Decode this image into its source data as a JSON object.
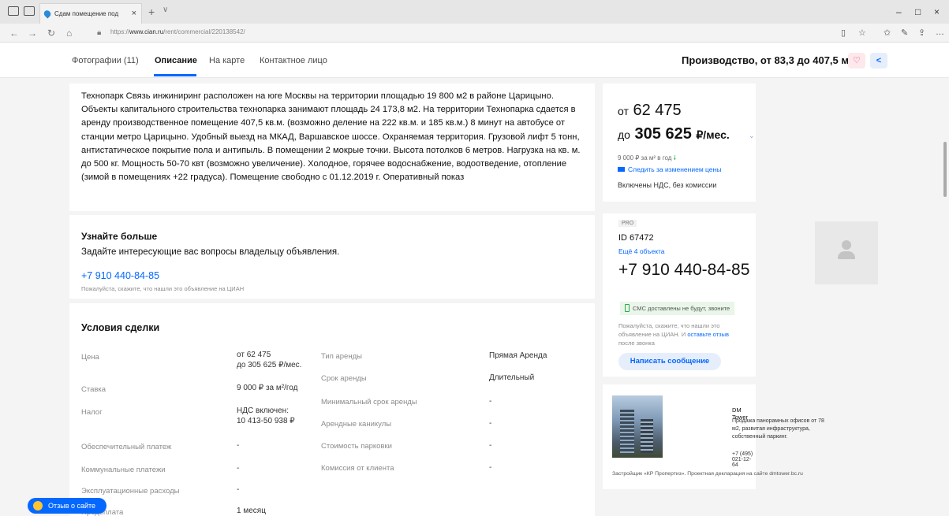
{
  "browser": {
    "tab_title": "Сдам помещение под",
    "url_prefix": "https://",
    "url_domain": "www.cian.ru",
    "url_path": "/rent/commercial/220138542/"
  },
  "header": {
    "tabs": [
      {
        "label": "Фотографии (11)"
      },
      {
        "label": "Описание"
      },
      {
        "label": "На карте"
      },
      {
        "label": "Контактное лицо"
      }
    ],
    "title": "Производство, от 83,3 до 407,5 м",
    "title_sup": "²"
  },
  "description": {
    "text": "Технопарк Связь инжиниринг расположен на юге Москвы на территории площадью 19 800 м2 в районе Царицыно. Объекты капитального строительства технопарка занимают площадь 24 173,8 м2. На территории Технопарка сдается в аренду производственное помещение 407,5 кв.м. (возможно деление на 222 кв.м. и 185 кв.м.) 8 минут на автобусе от станции метро Царицыно. Удобный выезд на МКАД, Варшавское шоссе. Охраняемая территория. Грузовой лифт 5 тонн, антистатическое покрытие пола и антипыль. В помещении 2 мокрые точки. Высота потолков 6 метров. Нагрузка на кв. м. до 500 кг. Мощность 50-70 квт (возможно увеличение). Холодное, горячее водоснабжение, водоотведение, отопление (зимой в помещениях +22 градуса). Помещение свободно с 01.12.2019 г. Оперативный показ"
  },
  "learn_more": {
    "title": "Узнайте больше",
    "subtitle": "Задайте интересующие вас вопросы владельцу объявления.",
    "phone": "+7 910 440-84-85",
    "note": "Пожалуйста, скажите, что нашли это объявление на ЦИАН"
  },
  "deal": {
    "title": "Условия сделки",
    "left": [
      {
        "label": "Цена",
        "value1": "от 62 475",
        "value2": "до 305 625 ₽/мес."
      },
      {
        "label": "Ставка",
        "value1": "9 000 ₽ за м²/год",
        "value2": ""
      },
      {
        "label": "Налог",
        "value1": "НДС включен:",
        "value2": "10 413-50 938 ₽"
      },
      {
        "label": "Обеспечительный платеж",
        "value1": "-",
        "value2": ""
      },
      {
        "label": "Коммунальные платежи",
        "value1": "-",
        "value2": ""
      },
      {
        "label": "Эксплуатационные расходы",
        "value1": "-",
        "value2": ""
      },
      {
        "label": "Предоплата",
        "value1": "1 месяц",
        "value2": ""
      }
    ],
    "right": [
      {
        "label": "Тип аренды",
        "value": "Прямая Аренда"
      },
      {
        "label": "Срок аренды",
        "value": "Длительный"
      },
      {
        "label": "Минимальный срок аренды",
        "value": "-"
      },
      {
        "label": "Арендные каникулы",
        "value": "-"
      },
      {
        "label": "Стоимость парковки",
        "value": "-"
      },
      {
        "label": "Комиссия от клиента",
        "value": "-"
      }
    ]
  },
  "price": {
    "prefix_from": "от",
    "from": "62 475",
    "prefix_to": "до",
    "to": "305 625",
    "unit": "₽/мес.",
    "rate": "9 000 ₽ за м² в год",
    "rate_arrow": "down-arrow-icon",
    "follow": "Следить за изменением цены",
    "vat": "Включены НДС, без комиссии"
  },
  "agent": {
    "badge": "PRO",
    "id": "ID 67472",
    "more": "Ещё 4 объекта",
    "phone": "+7 910 440-84-85",
    "sms": "СМС доставлены не будут, звоните",
    "note_before": "Пожалуйста, скажите, что нашли это объявление на ЦИАН. И",
    "note_link": "оставьте отзыв",
    "note_after": "после звонка",
    "message_button": "Написать сообщение"
  },
  "ad": {
    "title": "DM Tower",
    "text": "Продажа панорамных офисов от 78 м2, развитая инфраструктура, собственный паркинг.",
    "phone": "+7 (495) 021-12-64",
    "developer": "Застройщик «КР Пропертиз». Проектная декларация на сайте dmtower.bc.ru"
  },
  "feedback": {
    "label": "Отзыв о сайте"
  },
  "colors": {
    "accent": "#0468ff",
    "green": "#22b33a",
    "like": "#e8336a"
  }
}
